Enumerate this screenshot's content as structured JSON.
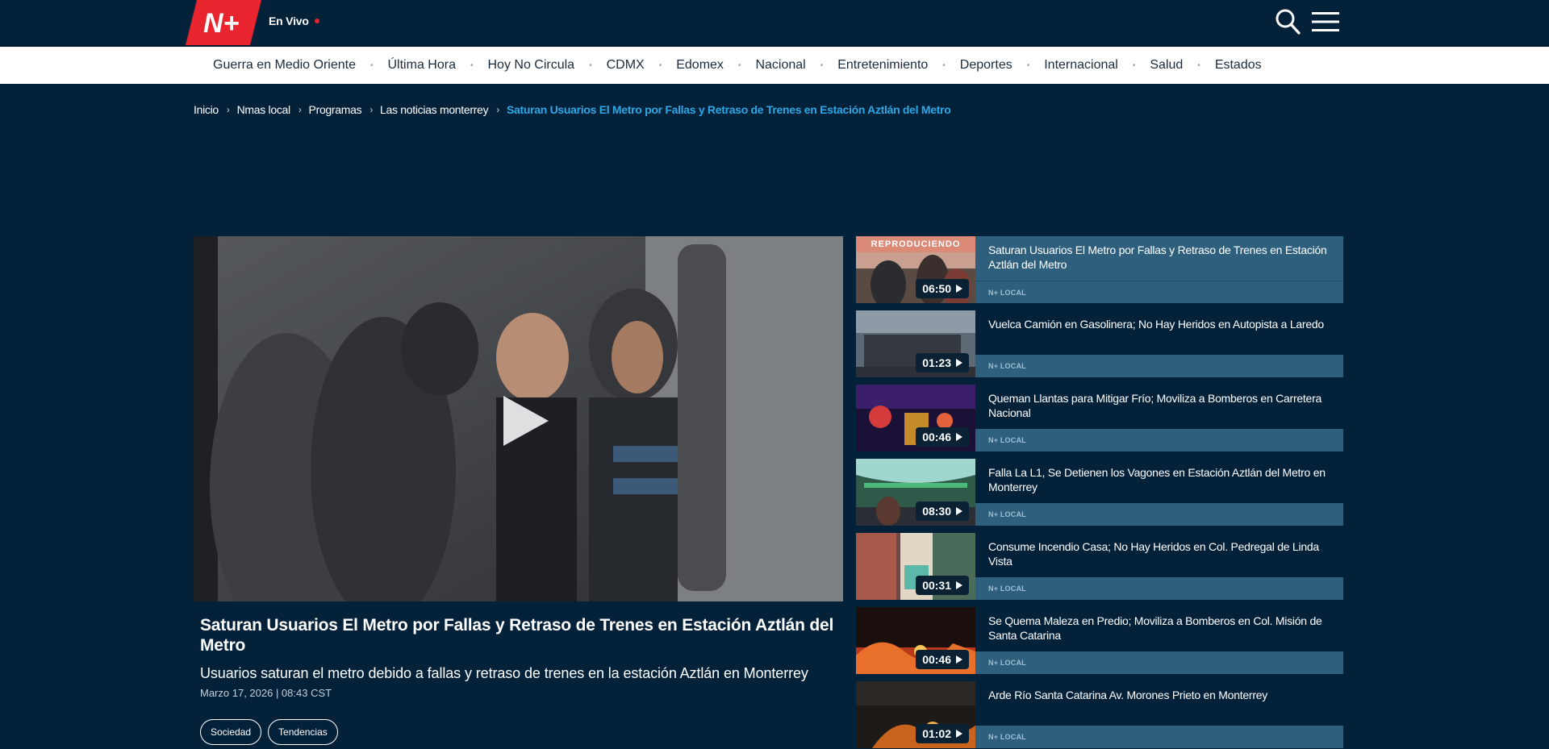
{
  "header": {
    "logo_text": "N+",
    "live_label": "En Vivo",
    "icons": {
      "search": "search-icon",
      "menu": "hamburger-menu-icon"
    },
    "colors": {
      "background": "#03223a",
      "brand_red": "#e8242f",
      "accent_blue": "#2ea7e6"
    }
  },
  "nav": {
    "items": [
      "Guerra en Medio Oriente",
      "Última Hora",
      "Hoy No Circula",
      "CDMX",
      "Edomex",
      "Nacional",
      "Entretenimiento",
      "Deportes",
      "Internacional",
      "Salud",
      "Estados"
    ]
  },
  "breadcrumb": {
    "items": [
      "Inicio",
      "Nmas local",
      "Programas",
      "Las noticias monterrey"
    ],
    "current": "Saturan Usuarios El Metro por Fallas y Retraso de Trenes en Estación Aztlán del Metro"
  },
  "video": {
    "title": "Saturan Usuarios El Metro por Fallas y Retraso de Trenes en Estación Aztlán del Metro",
    "subtitle": "Usuarios saturan el metro debido a fallas y retraso de trenes en la estación Aztlán en Monterrey",
    "date": "Marzo 17, 2026 | 08:43 CST",
    "tags": [
      "Sociedad",
      "Tendencias"
    ]
  },
  "playlist": {
    "now_playing_label": "REPRODUCIENDO",
    "items": [
      {
        "title": "Saturan Usuarios El Metro por Fallas y Retraso de Trenes en Estación Aztlán del Metro",
        "duration": "06:50",
        "source": "N+ LOCAL",
        "active": true
      },
      {
        "title": "Vuelca Camión en Gasolinera; No Hay Heridos en Autopista a Laredo",
        "duration": "01:23",
        "source": "N+ LOCAL"
      },
      {
        "title": "Queman Llantas para Mitigar Frío; Moviliza a Bomberos en Carretera Nacional",
        "duration": "00:46",
        "source": "N+ LOCAL"
      },
      {
        "title": "Falla La L1, Se Detienen los Vagones en Estación Aztlán del Metro en Monterrey",
        "duration": "08:30",
        "source": "N+ LOCAL"
      },
      {
        "title": "Consume Incendio Casa; No Hay Heridos en Col. Pedregal de Linda Vista",
        "duration": "00:31",
        "source": "N+ LOCAL"
      },
      {
        "title": "Se Quema Maleza en Predio; Moviliza a Bomberos en Col. Misión de Santa Catarina",
        "duration": "00:46",
        "source": "N+ LOCAL"
      },
      {
        "title": "Arde Río Santa Catarina Av. Morones Prieto en Monterrey",
        "duration": "01:02",
        "source": "N+ LOCAL"
      }
    ]
  }
}
